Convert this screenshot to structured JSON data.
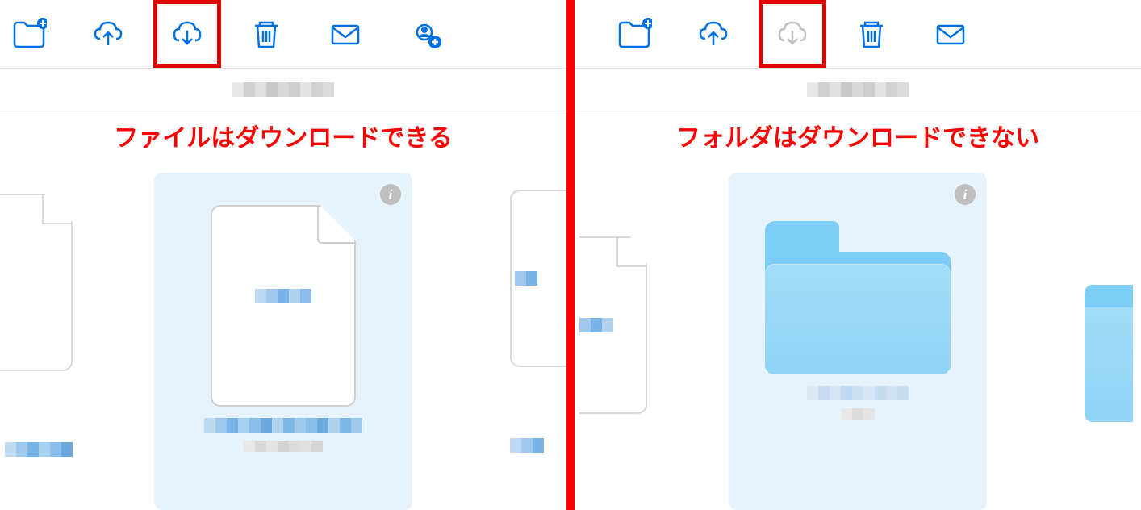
{
  "left": {
    "annotation": "ファイルはダウンロードできる",
    "toolbar": {
      "new_folder": "new-folder",
      "upload": "upload",
      "download": "download",
      "delete": "delete",
      "mail": "mail",
      "share": "share"
    },
    "download_enabled": true
  },
  "right": {
    "annotation": "フォルダはダウンロードできない",
    "toolbar": {
      "new_folder": "new-folder",
      "upload": "upload",
      "download": "download",
      "delete": "delete",
      "mail": "mail"
    },
    "download_enabled": false
  },
  "colors": {
    "primary": "#0071e3",
    "disabled": "#c0c0c0",
    "highlight": "#e10000",
    "selected_bg": "#e6f2fc",
    "folder_light": "#a3ddf8",
    "folder_dark": "#7dcdf5"
  }
}
